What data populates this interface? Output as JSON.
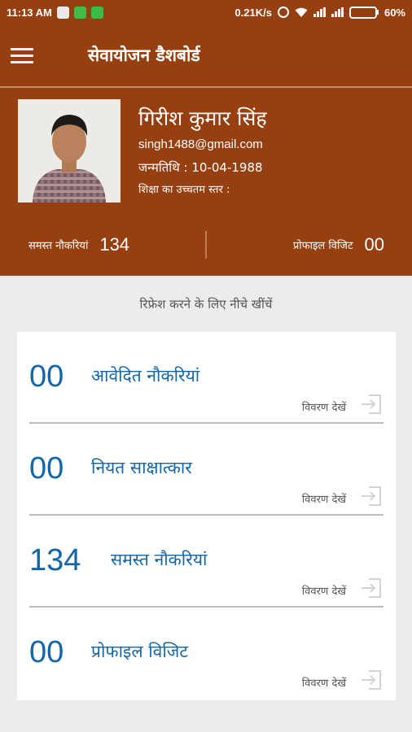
{
  "status_bar": {
    "time": "11:13 AM",
    "net_speed": "0.21K/s",
    "battery": "60%"
  },
  "app_bar": {
    "title": "सेवायोजन डैशबोर्ड",
    "menu_icon": "hamburger-menu-icon"
  },
  "profile": {
    "name": "गिरीश कुमार सिंह",
    "email": "singh1488@gmail.com",
    "dob": "जन्मतिथि : 10-04-1988",
    "education": "शिक्षा का उच्चतम स्तर :"
  },
  "stats": {
    "all_jobs_label": "समस्त नौकरियां",
    "all_jobs_value": "134",
    "profile_visits_label": "प्रोफाइल विजिट",
    "profile_visits_value": "00"
  },
  "refresh_hint": "रिफ्रेश करने के लिए नीचे खींचें",
  "cards": [
    {
      "count": "00",
      "title": "आवेदित नौकरियां",
      "details": "विवरण देखें",
      "icon": "open-details-icon"
    },
    {
      "count": "00",
      "title": "नियत साक्षात्कार",
      "details": "विवरण देखें",
      "icon": "open-details-icon"
    },
    {
      "count": "134",
      "title": "समस्त नौकरियां",
      "details": "विवरण देखें",
      "icon": "open-details-icon"
    },
    {
      "count": "00",
      "title": "प्रोफाइल विजिट",
      "details": "विवरण देखें",
      "icon": "open-details-icon"
    }
  ],
  "colors": {
    "primary": "#963f10",
    "accent_text": "#1466a8",
    "background": "#ececec"
  }
}
